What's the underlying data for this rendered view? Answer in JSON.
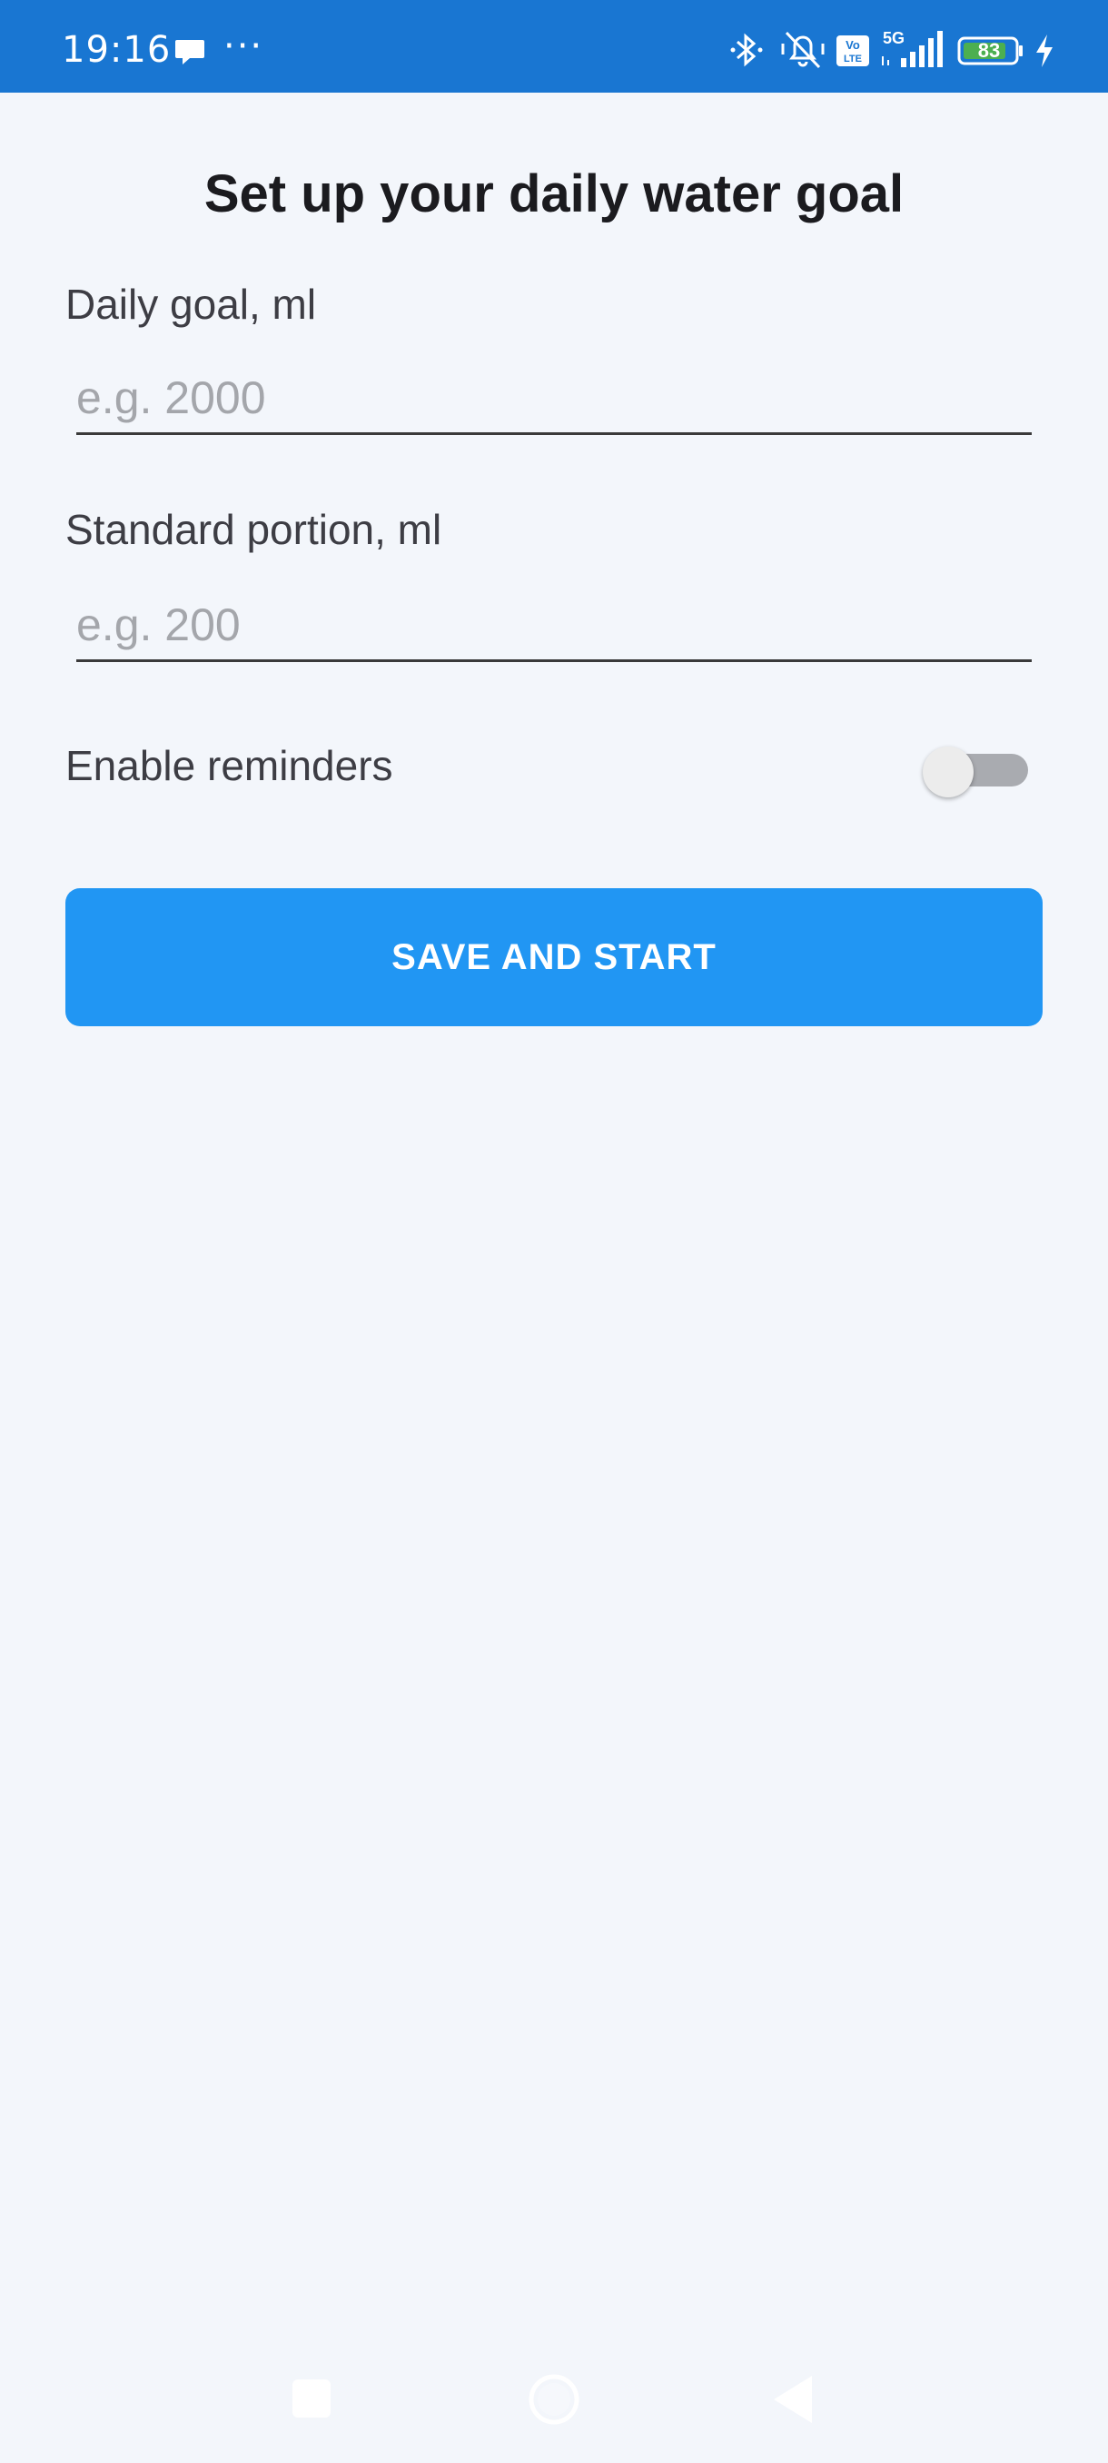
{
  "status_bar": {
    "time": "19:16",
    "more": "···",
    "battery_level": "83",
    "network": "5G",
    "background_color": "#1976d2",
    "icons": [
      "chat-bubble-icon",
      "bluetooth-icon",
      "bell-off-icon",
      "volte-icon",
      "signal-icon",
      "battery-icon",
      "charging-icon"
    ]
  },
  "page": {
    "title": "Set up your daily water goal"
  },
  "form": {
    "daily_goal": {
      "label": "Daily goal, ml",
      "value": "",
      "placeholder": "e.g. 2000"
    },
    "standard_portion": {
      "label": "Standard portion, ml",
      "value": "",
      "placeholder": "e.g. 200"
    },
    "reminders": {
      "label": "Enable reminders",
      "enabled": false
    },
    "submit_label": "SAVE AND START",
    "accent_color": "#2196f3"
  },
  "nav_bar": {
    "icons": [
      "recent-apps-icon",
      "home-icon",
      "back-icon"
    ]
  }
}
